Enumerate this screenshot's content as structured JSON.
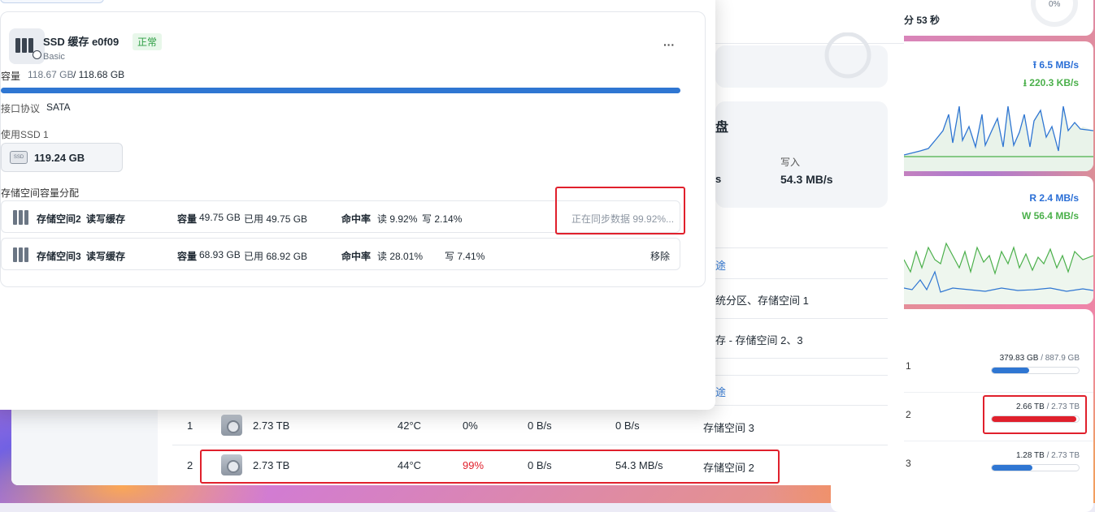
{
  "front": {
    "ssd_name": "SSD 缓存 e0f09",
    "status": "正常",
    "type": "Basic",
    "more_menu": "···",
    "capacity_label": "容量",
    "capacity_available": "118.67 GB",
    "capacity_total": "/ 118.68 GB",
    "capacity_used_fraction": 1.0,
    "interface_label": "接口协议",
    "interface_value": "SATA",
    "ssd_used_label": "使用SSD 1",
    "ssd_size": "119.24 GB",
    "ssd_icon_text": "SSD",
    "alloc_label": "存储空间容量分配",
    "pools": [
      {
        "name": "存储空间2",
        "mode": "读写缓存",
        "cap_label": "容量",
        "cap": "49.75 GB",
        "used": "已用 49.75 GB",
        "hit_label": "命中率",
        "read": "读 9.92%",
        "write": "写 2.14%",
        "action": "正在同步数据 99.92%..."
      },
      {
        "name": "存储空间3",
        "mode": "读写缓存",
        "cap_label": "容量",
        "cap": "68.93 GB",
        "used": "已用 68.92 GB",
        "hit_label": "命中率",
        "read": "读 28.01%",
        "write": "写 7.41%",
        "action": "移除"
      }
    ]
  },
  "background": {
    "disk_header_fragment": "盘",
    "write_label": "写入",
    "write_value": "54.3 MB/s",
    "s_fragment": "s",
    "usage_header": "途",
    "usage_rows": [
      "统分区、存储空间 1",
      "存 - 存储空间 2、3"
    ],
    "usage_header_2": "途",
    "disks": [
      {
        "index": "1",
        "size": "2.73 TB",
        "temp": "42°C",
        "util": "0%",
        "read": "0 B/s",
        "write": "0 B/s",
        "pool": "存储空间 3"
      },
      {
        "index": "2",
        "size": "2.73 TB",
        "temp": "44°C",
        "util": "99%",
        "read": "0 B/s",
        "write": "54.3 MB/s",
        "pool": "存储空间 2"
      }
    ]
  },
  "widgets": {
    "uptime_fragment": "分 53 秒",
    "cpu_percent": "0%",
    "net_up": "6.5 MB/s",
    "net_down": "220.3 KB/s",
    "io_read": "R  2.4 MB/s",
    "io_write": "W 56.4 MB/s",
    "volumes": [
      {
        "label": "1",
        "used": "379.83 GB",
        "total": "/ 887.9 GB",
        "fraction": 0.43
      },
      {
        "label": "2",
        "used": "2.66 TB",
        "total": "/ 2.73 TB",
        "fraction": 0.97
      },
      {
        "label": "3",
        "used": "1.28 TB",
        "total": "/ 2.73 TB",
        "fraction": 0.47
      }
    ]
  },
  "colors": {
    "accent": "#2f76d2",
    "alert": "#e0202c",
    "ok": "#2e9e44"
  }
}
